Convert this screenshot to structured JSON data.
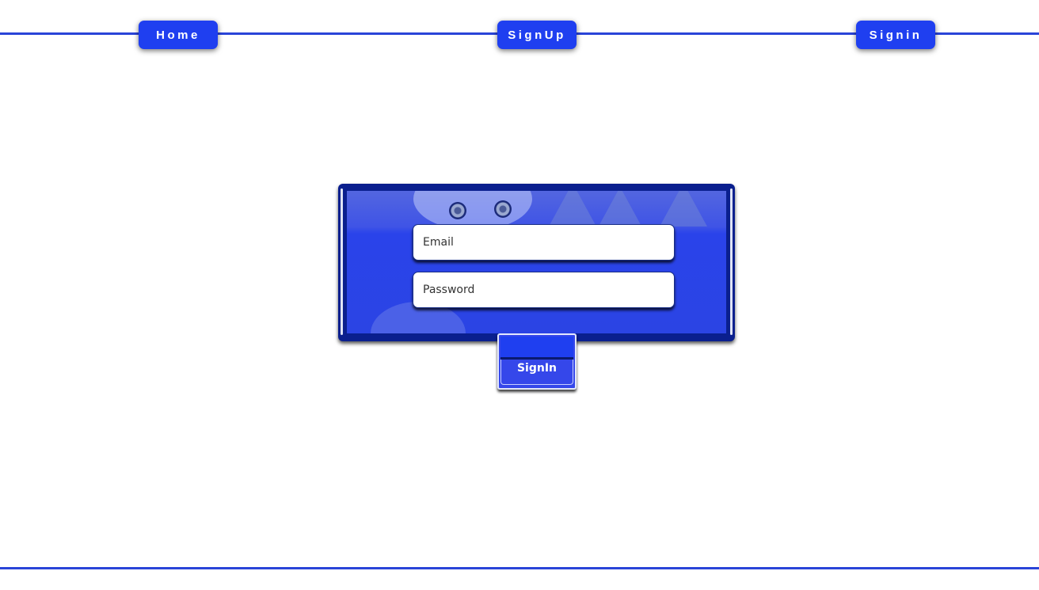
{
  "nav": {
    "home_label": "Home",
    "signup_label": "SignUp",
    "signin_label": "Signin"
  },
  "form": {
    "email_placeholder": "Email",
    "password_placeholder": "Password",
    "submit_label": "SignIn"
  },
  "colors": {
    "accent": "#1f3ff0",
    "card_frame": "#0a1f8e",
    "line": "#2a44d8"
  }
}
